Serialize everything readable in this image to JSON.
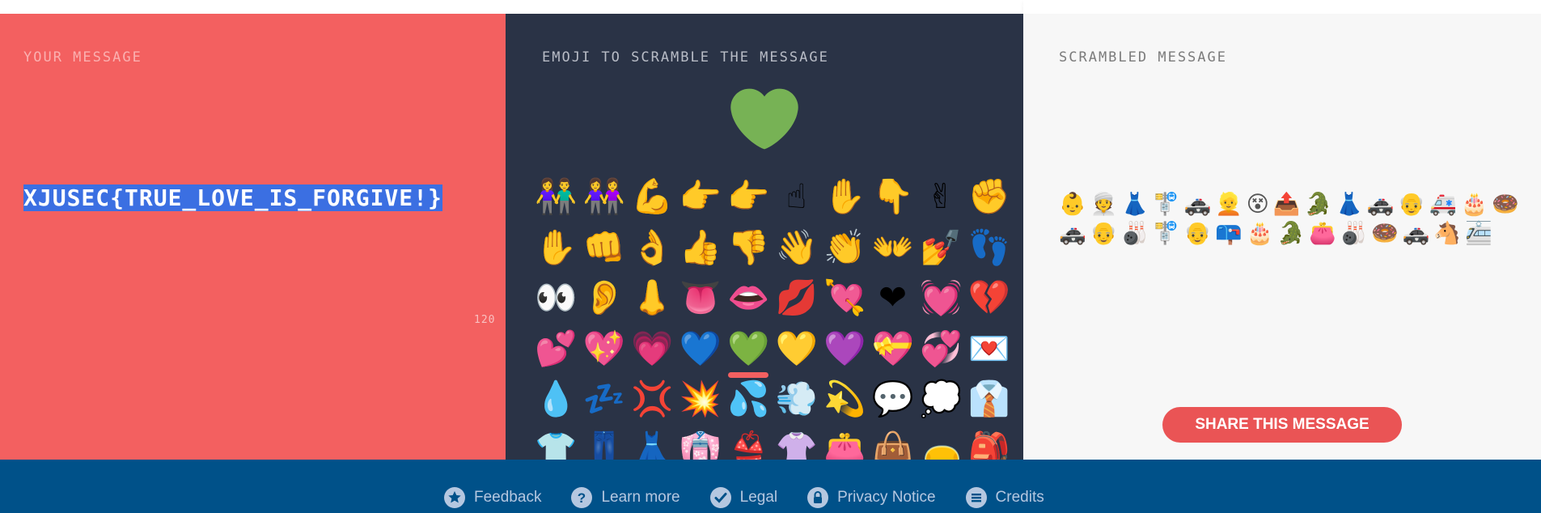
{
  "left": {
    "label": "YOUR MESSAGE",
    "message": "XJUSEC{TRUE_LOVE_IS_FORGIVE!}",
    "char_count": "120"
  },
  "middle": {
    "label": "EMOJI TO SCRAMBLE THE MESSAGE",
    "selected_emoji": "green-heart",
    "emoji_grid": [
      [
        "👫",
        "👭",
        "💪",
        "👉",
        "👉",
        "☝",
        "✋",
        "👇",
        "✌",
        "✊"
      ],
      [
        "✋",
        "👊",
        "👌",
        "👍",
        "👎",
        "👋",
        "👏",
        "👐",
        "💅",
        "👣"
      ],
      [
        "👀",
        "👂",
        "👃",
        "👅",
        "👄",
        "💋",
        "💘",
        "❤",
        "💓",
        "💔"
      ],
      [
        "💕",
        "💖",
        "💗",
        "💙",
        "💚",
        "💛",
        "💜",
        "💝",
        "💞",
        "💌"
      ],
      [
        "💧",
        "💤",
        "💢",
        "💥",
        "💦",
        "💨",
        "💫",
        "💬",
        "💭",
        "👔"
      ],
      [
        "👕",
        "👖",
        "👗",
        "👘",
        "👙",
        "👚",
        "👛",
        "👜",
        "👝",
        "🎒"
      ]
    ],
    "selected_index": [
      3,
      4
    ]
  },
  "right": {
    "label": "SCRAMBLED MESSAGE",
    "scrambled": "👶👳👗🚏🚓👱😵📤🐊👗🚓👴🚑🎂🍩🚓👴🎳🚏👴📪🎂🐊👛🎳🍩🚓🐴🚈",
    "share_label": "SHARE THIS MESSAGE"
  },
  "footer": {
    "links": [
      {
        "label": "Feedback",
        "icon": "star-icon"
      },
      {
        "label": "Learn more",
        "icon": "question-icon"
      },
      {
        "label": "Legal",
        "icon": "check-icon"
      },
      {
        "label": "Privacy Notice",
        "icon": "lock-icon"
      },
      {
        "label": "Credits",
        "icon": "list-icon"
      }
    ]
  },
  "colors": {
    "left_bg": "#f36060",
    "mid_bg": "#2a3346",
    "right_bg": "#f7f7f7",
    "footer_bg": "#005189",
    "accent": "#ea5455"
  }
}
